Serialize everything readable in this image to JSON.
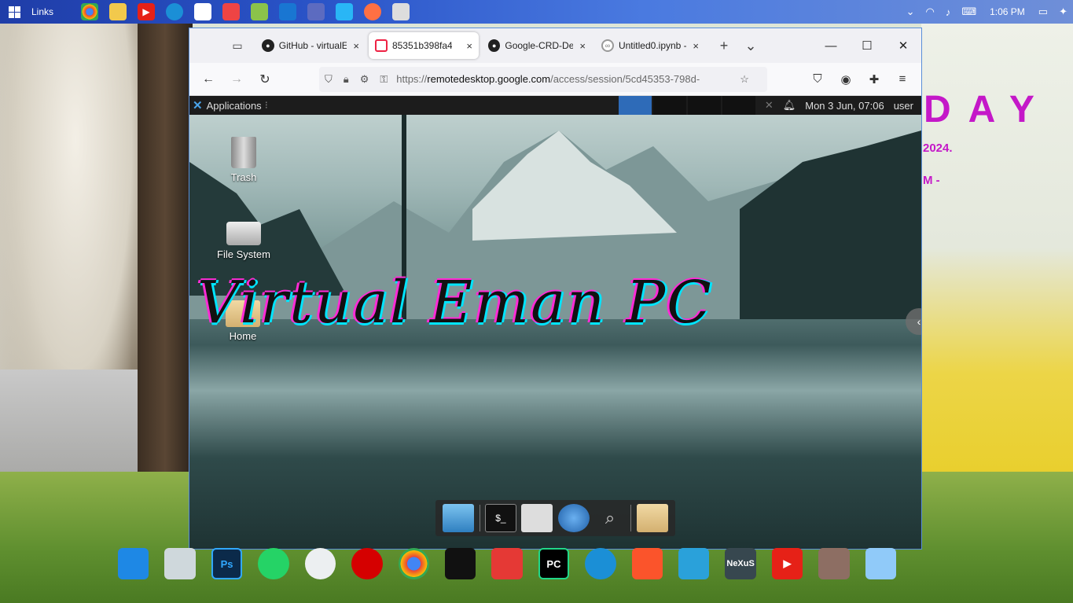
{
  "taskbar": {
    "links_label": "Links",
    "time": "1:06 PM",
    "quick_icons": [
      "chrome-icon",
      "file-explorer-icon",
      "youtube-icon",
      "edge-icon",
      "store-icon",
      "brave-icon",
      "notepad-icon",
      "messenger-icon",
      "calculator-icon",
      "vscode-icon",
      "firefox-icon",
      "app-icon"
    ]
  },
  "wallpaper": {
    "big_text": "DAY",
    "year_text": "2024.",
    "m_text": "M -"
  },
  "browser": {
    "tabs": [
      {
        "label": "GitHub - virtualE",
        "close": "×"
      },
      {
        "label": "85351b398fa4",
        "close": "×"
      },
      {
        "label": "Google-CRD-Del",
        "close": "×"
      },
      {
        "label": "Untitled0.ipynb -",
        "close": "×"
      }
    ],
    "new_tab": "+",
    "tab_list": "⌄",
    "url_host_prefix": "https://",
    "url_host": "remotedesktop.google.com",
    "url_path": "/access/session/5cd45353-798d-"
  },
  "remote": {
    "panel": {
      "applications_label": "Applications",
      "datetime": "Mon  3 Jun, 07:06",
      "user": "user"
    },
    "desktop_icons": {
      "trash": "Trash",
      "file_system": "File System",
      "home": "Home"
    },
    "overlay_text": "Virtual Eman PC"
  },
  "colors": {
    "accent_blue": "#2a54c8",
    "wall_magenta": "#c418c8",
    "overlay_cyan": "#00e5ff",
    "overlay_pink": "#ff2bd6"
  }
}
